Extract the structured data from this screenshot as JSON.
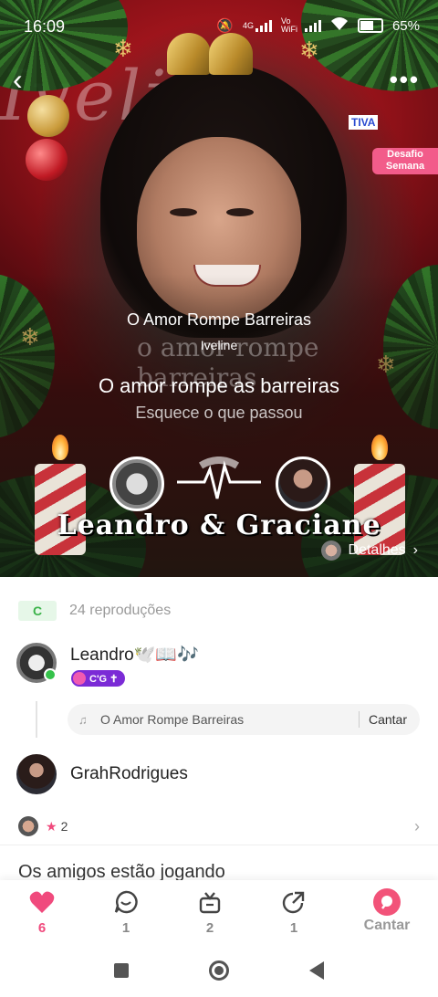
{
  "status": {
    "time": "16:09",
    "network": "4G",
    "volte": "Vo WiFi",
    "battery": "65%"
  },
  "hero": {
    "watermark": "Iveline",
    "promo_tag": "TIVA",
    "promo_label": "Desafio Semana",
    "song_title": "O Amor Rompe Barreiras",
    "artist": "Iveline",
    "lyric_ghost": "o amor rompe barreiras",
    "lyric_current": "O amor rompe as barreiras",
    "lyric_next": "Esquece o que passou",
    "duet_names": "Leandro & Graciane",
    "details_label": "Detalhes"
  },
  "stats": {
    "grade": "C",
    "plays": "24 reproduções"
  },
  "post": {
    "author": "Leandro🕊️📖🎶",
    "badge": "C'G ✝",
    "song_chip": {
      "title": "O Amor Rompe Barreiras",
      "action": "Cantar"
    },
    "partner": "GrahRodrigues",
    "likes_count": "2"
  },
  "friends_section": {
    "title": "Os amigos estão jogando"
  },
  "actions": [
    {
      "name": "like",
      "count": "6"
    },
    {
      "name": "comment",
      "count": "1"
    },
    {
      "name": "gift",
      "count": "2"
    },
    {
      "name": "share",
      "count": "1"
    },
    {
      "name": "sing",
      "label": "Cantar"
    }
  ],
  "colors": {
    "accent": "#f04a7d",
    "grade_green": "#3bb34a",
    "badge_purple": "#7b2bd6"
  }
}
